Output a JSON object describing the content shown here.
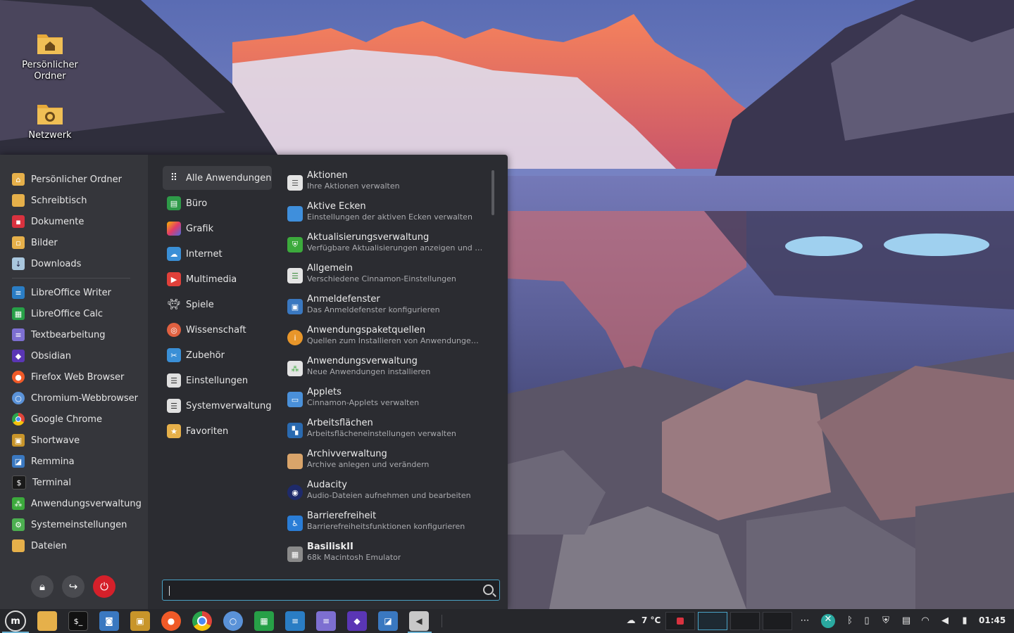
{
  "desktop": {
    "icons": [
      {
        "label_line1": "Persönlicher",
        "label_line2": "Ordner",
        "icon": "home-folder-icon"
      },
      {
        "label_line1": "Netzwerk",
        "label_line2": "",
        "icon": "network-folder-icon"
      }
    ]
  },
  "menu": {
    "favorites": [
      {
        "label": "Persönlicher Ordner",
        "icon": "home-folder-icon",
        "color": "#e6b04a"
      },
      {
        "label": "Schreibtisch",
        "icon": "desktop-folder-icon",
        "color": "#e6b04a"
      },
      {
        "label": "Dokumente",
        "icon": "documents-folder-icon",
        "color": "#d9323f"
      },
      {
        "label": "Bilder",
        "icon": "pictures-folder-icon",
        "color": "#e6b04a"
      },
      {
        "label": "Downloads",
        "icon": "downloads-folder-icon",
        "color": "#a9c7de"
      },
      {
        "label": "LibreOffice Writer",
        "icon": "libreoffice-writer-icon",
        "color": "#2a7dc4"
      },
      {
        "label": "LibreOffice Calc",
        "icon": "libreoffice-calc-icon",
        "color": "#27a047"
      },
      {
        "label": "Textbearbeitung",
        "icon": "text-editor-icon",
        "color": "#7d6fd1"
      },
      {
        "label": "Obsidian",
        "icon": "obsidian-icon",
        "color": "#5a36b5"
      },
      {
        "label": "Firefox Web Browser",
        "icon": "firefox-icon",
        "color": "#f05a28"
      },
      {
        "label": "Chromium-Webbrowser",
        "icon": "chromium-icon",
        "color": "#5a92d8"
      },
      {
        "label": "Google Chrome",
        "icon": "chrome-icon",
        "color": "#e0443a"
      },
      {
        "label": "Shortwave",
        "icon": "shortwave-icon",
        "color": "#c8952a"
      },
      {
        "label": "Remmina",
        "icon": "remmina-icon",
        "color": "#3a78c0"
      },
      {
        "label": "Terminal",
        "icon": "terminal-icon",
        "color": "#1a1a1a"
      },
      {
        "label": "Anwendungsverwaltung",
        "icon": "software-manager-icon",
        "color": "#3caa3c"
      },
      {
        "label": "Systemeinstellungen",
        "icon": "system-settings-icon",
        "color": "#4caf50"
      },
      {
        "label": "Dateien",
        "icon": "files-folder-icon",
        "color": "#e6b04a"
      }
    ],
    "system_buttons": [
      {
        "name": "lock-button",
        "icon": "lock-icon"
      },
      {
        "name": "logout-button",
        "icon": "logout-icon"
      },
      {
        "name": "shutdown-button",
        "icon": "power-icon"
      }
    ],
    "categories": [
      {
        "label": "Alle Anwendungen",
        "icon": "grid-icon",
        "color": "#3c3d42",
        "active": true
      },
      {
        "label": "Büro",
        "icon": "office-icon",
        "color": "#2e9a48"
      },
      {
        "label": "Grafik",
        "icon": "graphics-icon",
        "color": "#d0408a"
      },
      {
        "label": "Internet",
        "icon": "internet-icon",
        "color": "#3a8fd6"
      },
      {
        "label": "Multimedia",
        "icon": "multimedia-icon",
        "color": "#e0403a"
      },
      {
        "label": "Spiele",
        "icon": "games-icon",
        "color": "#3c3d42"
      },
      {
        "label": "Wissenschaft",
        "icon": "science-icon",
        "color": "#e06040"
      },
      {
        "label": "Zubehör",
        "icon": "accessories-icon",
        "color": "#3a8fd6"
      },
      {
        "label": "Einstellungen",
        "icon": "settings-icon",
        "color": "#e0e0e0"
      },
      {
        "label": "Systemverwaltung",
        "icon": "administration-icon",
        "color": "#e0e0e0"
      },
      {
        "label": "Favoriten",
        "icon": "favorites-folder-icon",
        "color": "#e6b04a"
      }
    ],
    "apps": [
      {
        "name": "Aktionen",
        "desc": "Ihre Aktionen verwalten",
        "icon": "actions-icon",
        "color": "#e4e4e4"
      },
      {
        "name": "Aktive Ecken",
        "desc": "Einstellungen der aktiven Ecken verwalten",
        "icon": "hot-corners-icon",
        "color": "#3f8fdc"
      },
      {
        "name": "Aktualisierungsverwaltung",
        "desc": "Verfügbare Aktualisierungen anzeigen und inst...",
        "icon": "update-manager-icon",
        "color": "#3caa3c"
      },
      {
        "name": "Allgemein",
        "desc": "Verschiedene Cinnamon-Einstellungen",
        "icon": "general-settings-icon",
        "color": "#e4e4e4"
      },
      {
        "name": "Anmeldefenster",
        "desc": "Das Anmeldefenster konfigurieren",
        "icon": "login-window-icon",
        "color": "#3a78c0"
      },
      {
        "name": "Anwendungspaketquellen",
        "desc": "Quellen zum Installieren von Anwendungen und...",
        "icon": "software-sources-icon",
        "color": "#e8962a"
      },
      {
        "name": "Anwendungsverwaltung",
        "desc": "Neue Anwendungen installieren",
        "icon": "software-manager-icon",
        "color": "#e4e4e4"
      },
      {
        "name": "Applets",
        "desc": "Cinnamon-Applets verwalten",
        "icon": "applets-icon",
        "color": "#4a90d9"
      },
      {
        "name": "Arbeitsflächen",
        "desc": "Arbeitsflächeneinstellungen verwalten",
        "icon": "workspaces-icon",
        "color": "#2a6ab0"
      },
      {
        "name": "Archivverwaltung",
        "desc": "Archive anlegen und verändern",
        "icon": "archive-manager-icon",
        "color": "#d9a46a"
      },
      {
        "name": "Audacity",
        "desc": "Audio-Dateien aufnehmen und bearbeiten",
        "icon": "audacity-icon",
        "color": "#1e2a6a"
      },
      {
        "name": "Barrierefreiheit",
        "desc": "Barrierefreiheitsfunktionen konfigurieren",
        "icon": "accessibility-icon",
        "color": "#2a7dd6"
      },
      {
        "name": "BasiliskII",
        "desc": "68k Macintosh Emulator",
        "icon": "basilisk-icon",
        "color": "#8a8a8a"
      }
    ],
    "search": {
      "value": "",
      "placeholder": ""
    }
  },
  "taskbar": {
    "launchers": [
      {
        "name": "mint-menu-button",
        "icon": "linux-mint-icon",
        "color": "#26272b"
      },
      {
        "name": "files-launcher",
        "icon": "folder-icon",
        "color": "#e6b04a"
      },
      {
        "name": "terminal-launcher",
        "icon": "terminal-icon",
        "color": "#111111"
      },
      {
        "name": "screenshot-launcher",
        "icon": "camera-icon",
        "color": "#3a78c0"
      },
      {
        "name": "shortwave-launcher",
        "icon": "radio-icon",
        "color": "#c8952a"
      },
      {
        "name": "firefox-launcher",
        "icon": "firefox-icon",
        "color": "#f05a28"
      },
      {
        "name": "chrome-launcher",
        "icon": "chrome-icon",
        "color": "#e0443a"
      },
      {
        "name": "chromium-launcher",
        "icon": "chromium-icon",
        "color": "#5a92d8"
      },
      {
        "name": "calc-launcher",
        "icon": "libreoffice-calc-icon",
        "color": "#27a047"
      },
      {
        "name": "writer-launcher",
        "icon": "libreoffice-writer-icon",
        "color": "#2a7dc4"
      },
      {
        "name": "text-editor-launcher",
        "icon": "text-editor-icon",
        "color": "#7d6fd1"
      },
      {
        "name": "obsidian-launcher",
        "icon": "obsidian-icon",
        "color": "#5a36b5"
      },
      {
        "name": "remmina-launcher",
        "icon": "remmina-icon",
        "color": "#3a78c0"
      },
      {
        "name": "sound-launcher",
        "icon": "speaker-icon",
        "color": "#c8c8c8"
      }
    ],
    "weather": "7 °C",
    "clock": "01:45",
    "tray_icons": [
      "more-icon",
      "xfce-icon",
      "bluetooth-icon",
      "clipboard-icon",
      "shield-icon",
      "printer-icon",
      "wifi-icon",
      "volume-icon",
      "battery-icon"
    ]
  },
  "colors": {
    "accent": "#4aa3c6",
    "menu_bg": "#2b2c31",
    "sidebar_bg": "#35363b",
    "taskbar_bg": "#26272b"
  }
}
